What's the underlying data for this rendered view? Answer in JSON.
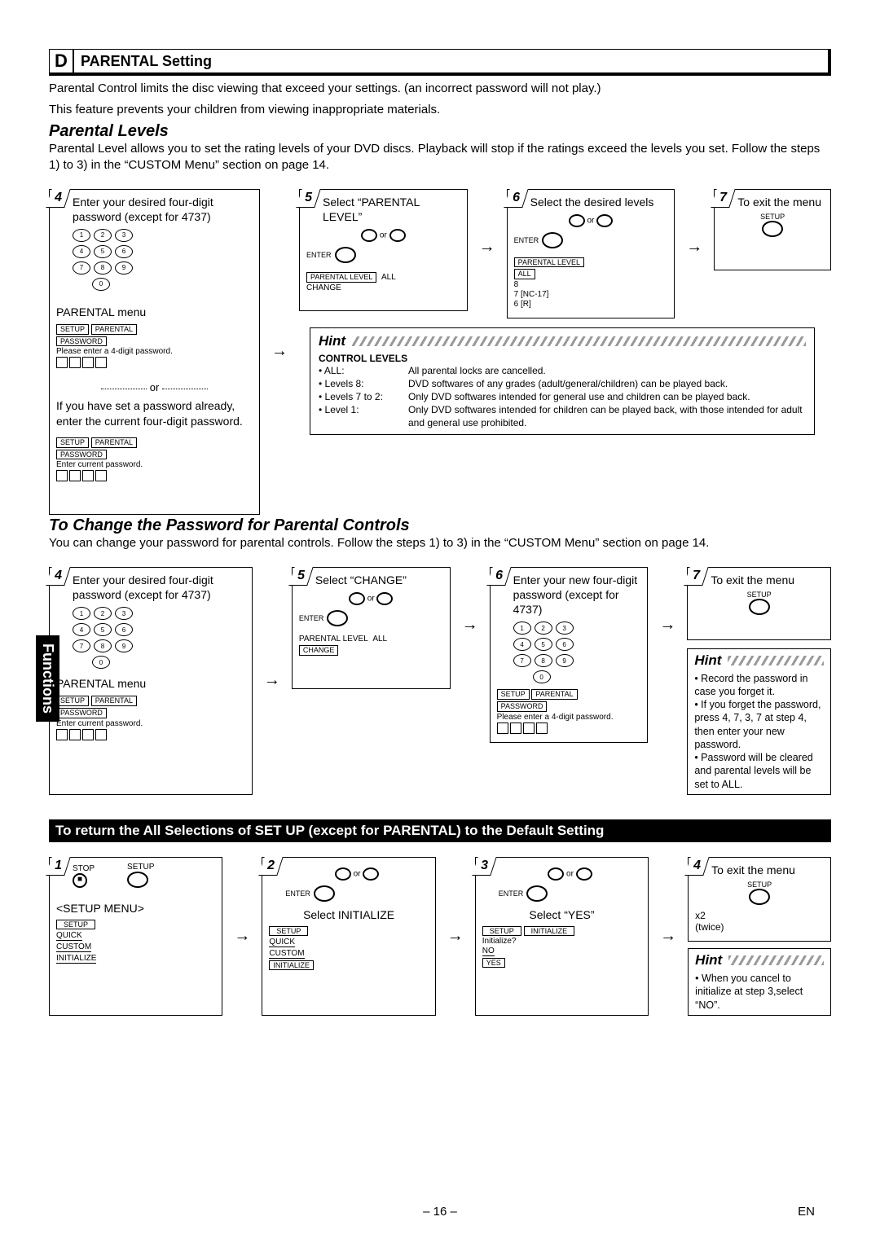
{
  "header": {
    "letter": "D",
    "title": "PARENTAL Setting"
  },
  "intro1": "Parental Control limits the disc viewing that exceed your settings. (an incorrect password will not play.)",
  "intro2": "This feature prevents your children from viewing inappropriate materials.",
  "levels_heading": "Parental Levels",
  "levels_para": "Parental Level allows you to set the rating levels of your DVD discs. Playback will stop if the ratings exceed the levels you set. Follow the steps 1) to 3) in the “CUSTOM Menu” section on page 14.",
  "steps": {
    "s4": {
      "num": "4",
      "text": "Enter your desired four-digit password (except for 4737)",
      "menu_label": "PARENTAL menu"
    },
    "s4_osd": {
      "tab1": "SETUP",
      "tab2": "PARENTAL",
      "row": "PASSWORD",
      "prompt": "Please enter a 4-digit password."
    },
    "s4_or": "or",
    "s4_alt": "If you have set a password already, enter the current four-digit password.",
    "s4_alt_osd": {
      "tab1": "SETUP",
      "tab2": "PARENTAL",
      "row": "PASSWORD",
      "prompt": "Enter current password."
    },
    "s5": {
      "num": "5",
      "text": "Select “PARENTAL LEVEL”"
    },
    "s5_osd": {
      "row1": "PARENTAL LEVEL",
      "val1": "ALL",
      "row2": "CHANGE"
    },
    "s6": {
      "num": "6",
      "text": "Select the desired levels"
    },
    "s6_osd": {
      "row1": "PARENTAL LEVEL",
      "opts": [
        "ALL",
        "8",
        "7 [NC-17]",
        "6 [R]"
      ]
    },
    "s7": {
      "num": "7",
      "text": "To exit the menu",
      "btn": "SETUP"
    },
    "enter": "ENTER",
    "or_word": "or"
  },
  "hint1": {
    "title": "Hint",
    "subtitle": "CONTROL LEVELS",
    "rows": [
      {
        "k": "• ALL:",
        "v": "All parental locks are cancelled."
      },
      {
        "k": "• Levels 8:",
        "v": "DVD softwares of any grades (adult/general/children) can be played back."
      },
      {
        "k": "• Levels 7 to 2:",
        "v": "Only DVD softwares intended for general use and children can be played back."
      },
      {
        "k": "• Level 1:",
        "v": "Only DVD softwares intended for children can be played back, with those intended for adult and general use prohibited."
      }
    ]
  },
  "change_pw": {
    "heading": "To Change the Password for Parental Controls",
    "para": "You can change your password for parental controls.  Follow the steps 1) to 3) in the “CUSTOM Menu” section on page 14.",
    "s4": {
      "num": "4",
      "text": "Enter your desired four-digit password (except for 4737)",
      "menu_label": "PARENTAL menu"
    },
    "s4_osd": {
      "tab1": "SETUP",
      "tab2": "PARENTAL",
      "row": "PASSWORD",
      "prompt": "Enter current password."
    },
    "s5": {
      "num": "5",
      "text": "Select “CHANGE”"
    },
    "s5_osd": {
      "row1": "PARENTAL LEVEL",
      "val1": "ALL",
      "row2": "CHANGE"
    },
    "s6": {
      "num": "6",
      "text": "Enter your new four-digit password (except for 4737)"
    },
    "s6_osd": {
      "tab1": "SETUP",
      "tab2": "PARENTAL",
      "row": "PASSWORD",
      "prompt": "Please enter a 4-digit password."
    },
    "s7": {
      "num": "7",
      "text": "To exit the menu",
      "btn": "SETUP"
    }
  },
  "hint2": {
    "title": "Hint",
    "items": [
      "Record the password in case you forget it.",
      "If you forget the password, press 4, 7, 3, 7 at step 4, then enter your new password.",
      "Password will be cleared and parental levels will be set to ALL."
    ]
  },
  "blackbar": "To return the All Selections of SET UP (except for PARENTAL) to the Default Setting",
  "init": {
    "s1": {
      "num": "1",
      "stop": "STOP",
      "setup": "SETUP",
      "menu": "<SETUP MENU>",
      "m_hdr": "SETUP",
      "items": [
        "QUICK",
        "CUSTOM",
        "INITIALIZE"
      ]
    },
    "s2": {
      "num": "2",
      "text": "Select INITIALIZE",
      "m_hdr": "SETUP",
      "items": [
        "QUICK",
        "CUSTOM",
        "INITIALIZE"
      ]
    },
    "s3": {
      "num": "3",
      "text": "Select “YES”",
      "m_hdr": "SETUP",
      "m_tab": "INITIALIZE",
      "prompt": "Initialize?",
      "opts": [
        "NO",
        "YES"
      ]
    },
    "s4": {
      "num": "4",
      "text": "To exit the menu",
      "x2": "x2",
      "twice": "(twice)",
      "btn": "SETUP"
    }
  },
  "hint3": {
    "title": "Hint",
    "text": "When you cancel to initialize at step 3,select “NO”."
  },
  "side_tab": "Functions",
  "footer": {
    "page": "– 16 –",
    "lang": "EN"
  }
}
